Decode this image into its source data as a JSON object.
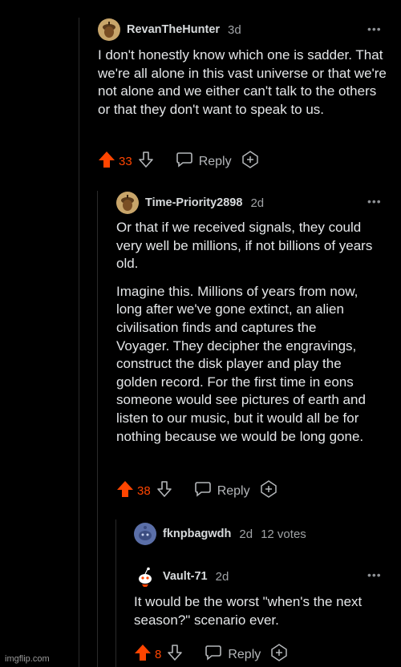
{
  "comments": [
    {
      "username": "RevanTheHunter",
      "age": "3d",
      "paragraphs": [
        "I don't honestly know which one is sadder. That we're all alone in this vast universe or that we're not alone and we either can't talk to the others or that they don't want to speak to us."
      ],
      "score": "33",
      "reply_label": "Reply",
      "avatar_icon": "acorn-avatar-icon"
    },
    {
      "username": "Time-Priority2898",
      "age": "2d",
      "paragraphs": [
        "Or that if we received signals, they could very well be millions, if not billions of years old.",
        "Imagine this. Millions of years from now, long after we've gone extinct, an alien civilisation finds and captures the Voyager. They decipher the engravings, construct the disk player and play the golden record. For the first time in eons someone would see pictures of earth and listen to our music, but it would all be for nothing because we would be long gone."
      ],
      "score": "38",
      "reply_label": "Reply",
      "avatar_icon": "acorn-avatar-icon"
    },
    {
      "username": "fknpbagwdh",
      "age": "2d",
      "votes": "12 votes",
      "avatar_icon": "blue-snoo-avatar-icon"
    },
    {
      "username": "Vault-71",
      "age": "2d",
      "paragraphs": [
        "It would be the worst \"when's the next season?\" scenario ever."
      ],
      "score": "8",
      "reply_label": "Reply",
      "avatar_icon": "snoo-avatar-icon"
    }
  ],
  "more_glyph": "•••",
  "watermark": "imgflip.com",
  "colors": {
    "background": "#000000",
    "upvote": "#ff4500",
    "text": "#e4e6e8",
    "muted": "#a0a3a6"
  }
}
